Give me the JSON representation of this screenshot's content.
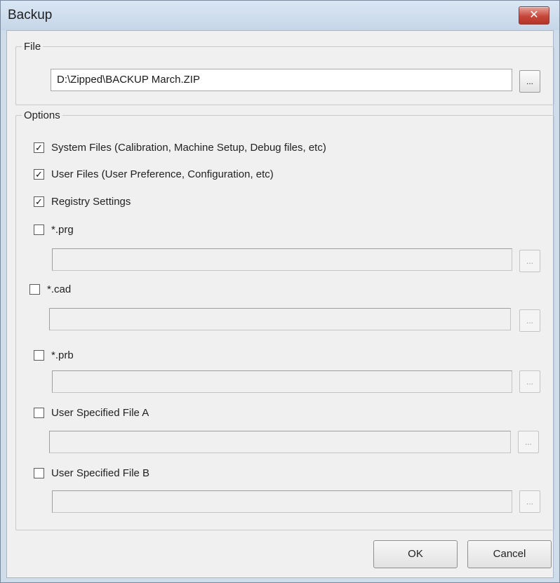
{
  "window": {
    "title": "Backup",
    "close_glyph": "✕"
  },
  "file_group": {
    "legend": "File",
    "path_value": "D:\\Zipped\\BACKUP March.ZIP",
    "browse_label": "..."
  },
  "options_group": {
    "legend": "Options",
    "checks": [
      {
        "label": "System Files (Calibration, Machine Setup, Debug files, etc)",
        "checked": true,
        "mark": "✓"
      },
      {
        "label": "User Files (User Preference, Configuration, etc)",
        "checked": true,
        "mark": "✓"
      },
      {
        "label": "Registry Settings",
        "checked": true,
        "mark": "✓"
      },
      {
        "label": "*.prg",
        "checked": false,
        "mark": "",
        "path_value": "",
        "browse_label": "..."
      },
      {
        "label": "*.cad",
        "checked": false,
        "mark": "",
        "path_value": "",
        "browse_label": "..."
      },
      {
        "label": "*.prb",
        "checked": false,
        "mark": "",
        "path_value": "",
        "browse_label": "..."
      },
      {
        "label": "User Specified File A",
        "checked": false,
        "mark": "",
        "path_value": "",
        "browse_label": "..."
      },
      {
        "label": "User Specified File B",
        "checked": false,
        "mark": "",
        "path_value": "",
        "browse_label": "..."
      }
    ]
  },
  "buttons": {
    "ok": "OK",
    "cancel": "Cancel"
  },
  "icons": {
    "close": "close-icon",
    "check": "checkmark-icon"
  }
}
